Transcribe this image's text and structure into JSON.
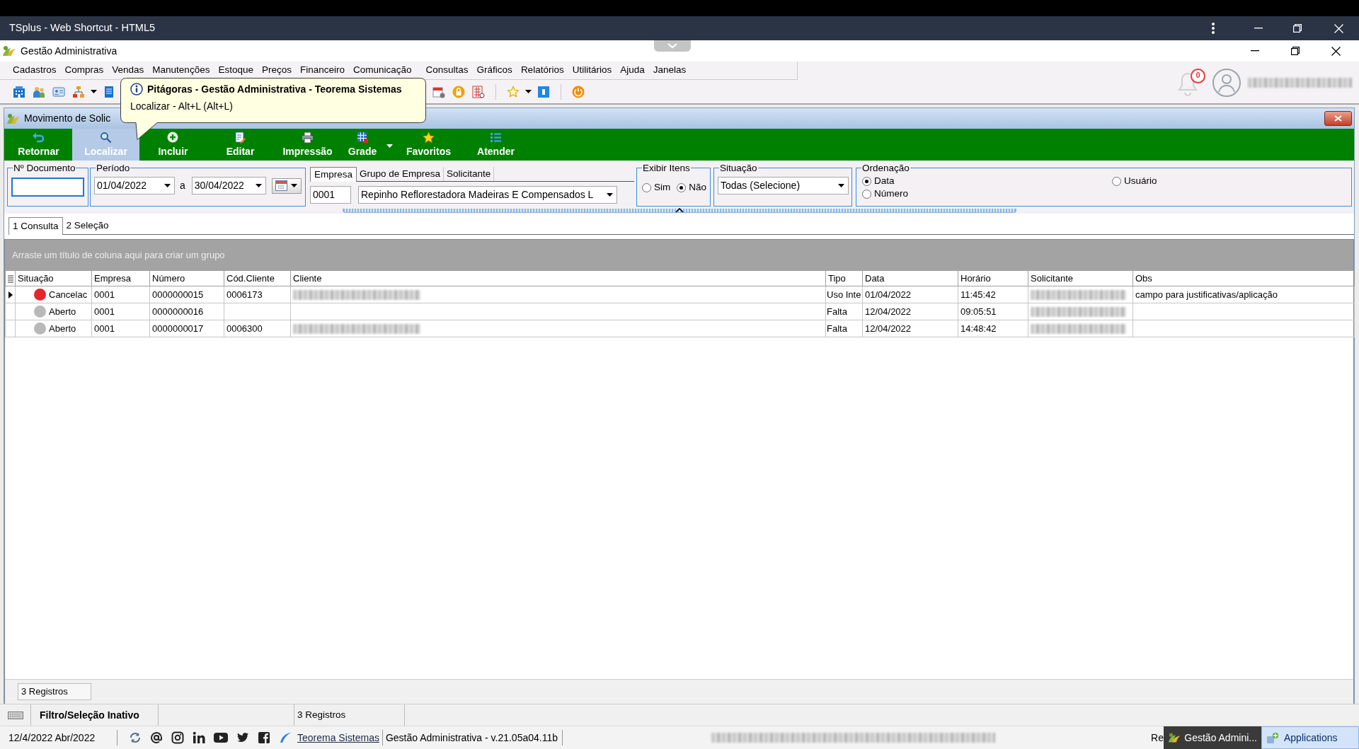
{
  "host_window": {
    "title": "TSplus - Web Shortcut - HTML5"
  },
  "app_window": {
    "title": "Gestão Administrativa"
  },
  "menu": [
    "Cadastros",
    "Compras",
    "Vendas",
    "Manutenções",
    "Estoque",
    "Preços",
    "Financeiro",
    "Comunicação",
    "Consultas",
    "Gráficos",
    "Relatórios",
    "Utilitários",
    "Ajuda",
    "Janelas"
  ],
  "notifications": {
    "count": "0"
  },
  "user": {
    "name_redacted": true
  },
  "tooltip": {
    "title": "Pitágoras - Gestão Administrativa - Teorema Sistemas",
    "text": "Localizar - Alt+L (Alt+L)"
  },
  "document_window": {
    "title": "Movimento de Solic"
  },
  "actions": [
    {
      "label": "Retornar",
      "kind": "button",
      "selected": false
    },
    {
      "label": "Localizar",
      "kind": "button",
      "selected": true
    },
    {
      "label": "Incluir",
      "kind": "button",
      "selected": false
    },
    {
      "label": "Editar",
      "kind": "button",
      "selected": false
    },
    {
      "label": "Impressão",
      "kind": "button",
      "selected": false
    },
    {
      "label": "Grade",
      "kind": "split",
      "selected": false
    },
    {
      "label": "Favoritos",
      "kind": "button",
      "selected": false
    },
    {
      "label": "Atender",
      "kind": "button",
      "selected": false
    }
  ],
  "filters": {
    "documento": {
      "label": "Nº Documento"
    },
    "periodo": {
      "label": "Período",
      "from": "01/04/2022",
      "separator": "a",
      "to": "30/04/2022"
    },
    "company_tabs": [
      {
        "label": "Empresa",
        "selected": true
      },
      {
        "label": "Grupo de Empresa",
        "selected": false
      },
      {
        "label": "Solicitante",
        "selected": false
      }
    ],
    "company": {
      "code": "0001",
      "name": "Repinho Reflorestadora Madeiras E Compensados L"
    },
    "exibir_itens": {
      "label": "Exibir Itens",
      "options": [
        {
          "label": "Sim",
          "selected": false
        },
        {
          "label": "Não",
          "selected": true
        }
      ]
    },
    "situacao": {
      "label": "Situação",
      "value": "Todas (Selecione)"
    },
    "ordenacao": {
      "label": "Ordenação",
      "options": [
        {
          "label": "Data",
          "selected": true
        },
        {
          "label": "Número",
          "selected": false
        },
        {
          "label": "Usuário",
          "selected": false
        }
      ]
    }
  },
  "view_tabs": [
    {
      "label": "1 Consulta",
      "selected": true
    },
    {
      "label": "2 Seleção",
      "selected": false
    }
  ],
  "grid": {
    "group_hint": "Arraste um título de coluna aqui para criar um grupo",
    "columns": [
      "Situação",
      "Empresa",
      "Número",
      "Cód.Cliente",
      "Cliente",
      "Tipo",
      "Data",
      "Horário",
      "Solicitante",
      "Obs"
    ],
    "rows": [
      {
        "selected": true,
        "status": "Cancelac",
        "color": "#e3262c",
        "empresa": "0001",
        "numero": "0000000015",
        "cod_cliente": "0006173",
        "cliente_redacted": true,
        "tipo": "Uso Inte",
        "data": "01/04/2022",
        "horario": "11:45:42",
        "solicitante_redacted": true,
        "obs": "campo para justificativas/aplicação"
      },
      {
        "selected": false,
        "status": "Aberto",
        "color": "#b9b9b9",
        "empresa": "0001",
        "numero": "0000000016",
        "cliente_redacted": false,
        "tipo": "Falta",
        "data": "12/04/2022",
        "horario": "09:05:51",
        "solicitante_redacted": true
      },
      {
        "selected": false,
        "status": "Aberto",
        "color": "#b9b9b9",
        "empresa": "0001",
        "numero": "0000000017",
        "cod_cliente": "0006300",
        "cliente_redacted": true,
        "tipo": "Falta",
        "data": "12/04/2022",
        "horario": "14:48:42",
        "solicitante_redacted": true
      }
    ],
    "footer": "3 Registros"
  },
  "status_bar": {
    "filter_state": "Filtro/Seleção Inativo",
    "count": "3 Registros"
  },
  "taskbar": {
    "date": "12/4/2022 Abr/2022",
    "link": "Teorema Sistemas",
    "version": "Gestão Administrativa - v.21.05a04.11b",
    "company_redacted": true,
    "cut_text": "Re",
    "buttons": [
      {
        "label": "Gestão Admini...",
        "selected": false
      },
      {
        "label": "Applications",
        "selected": true
      }
    ]
  }
}
